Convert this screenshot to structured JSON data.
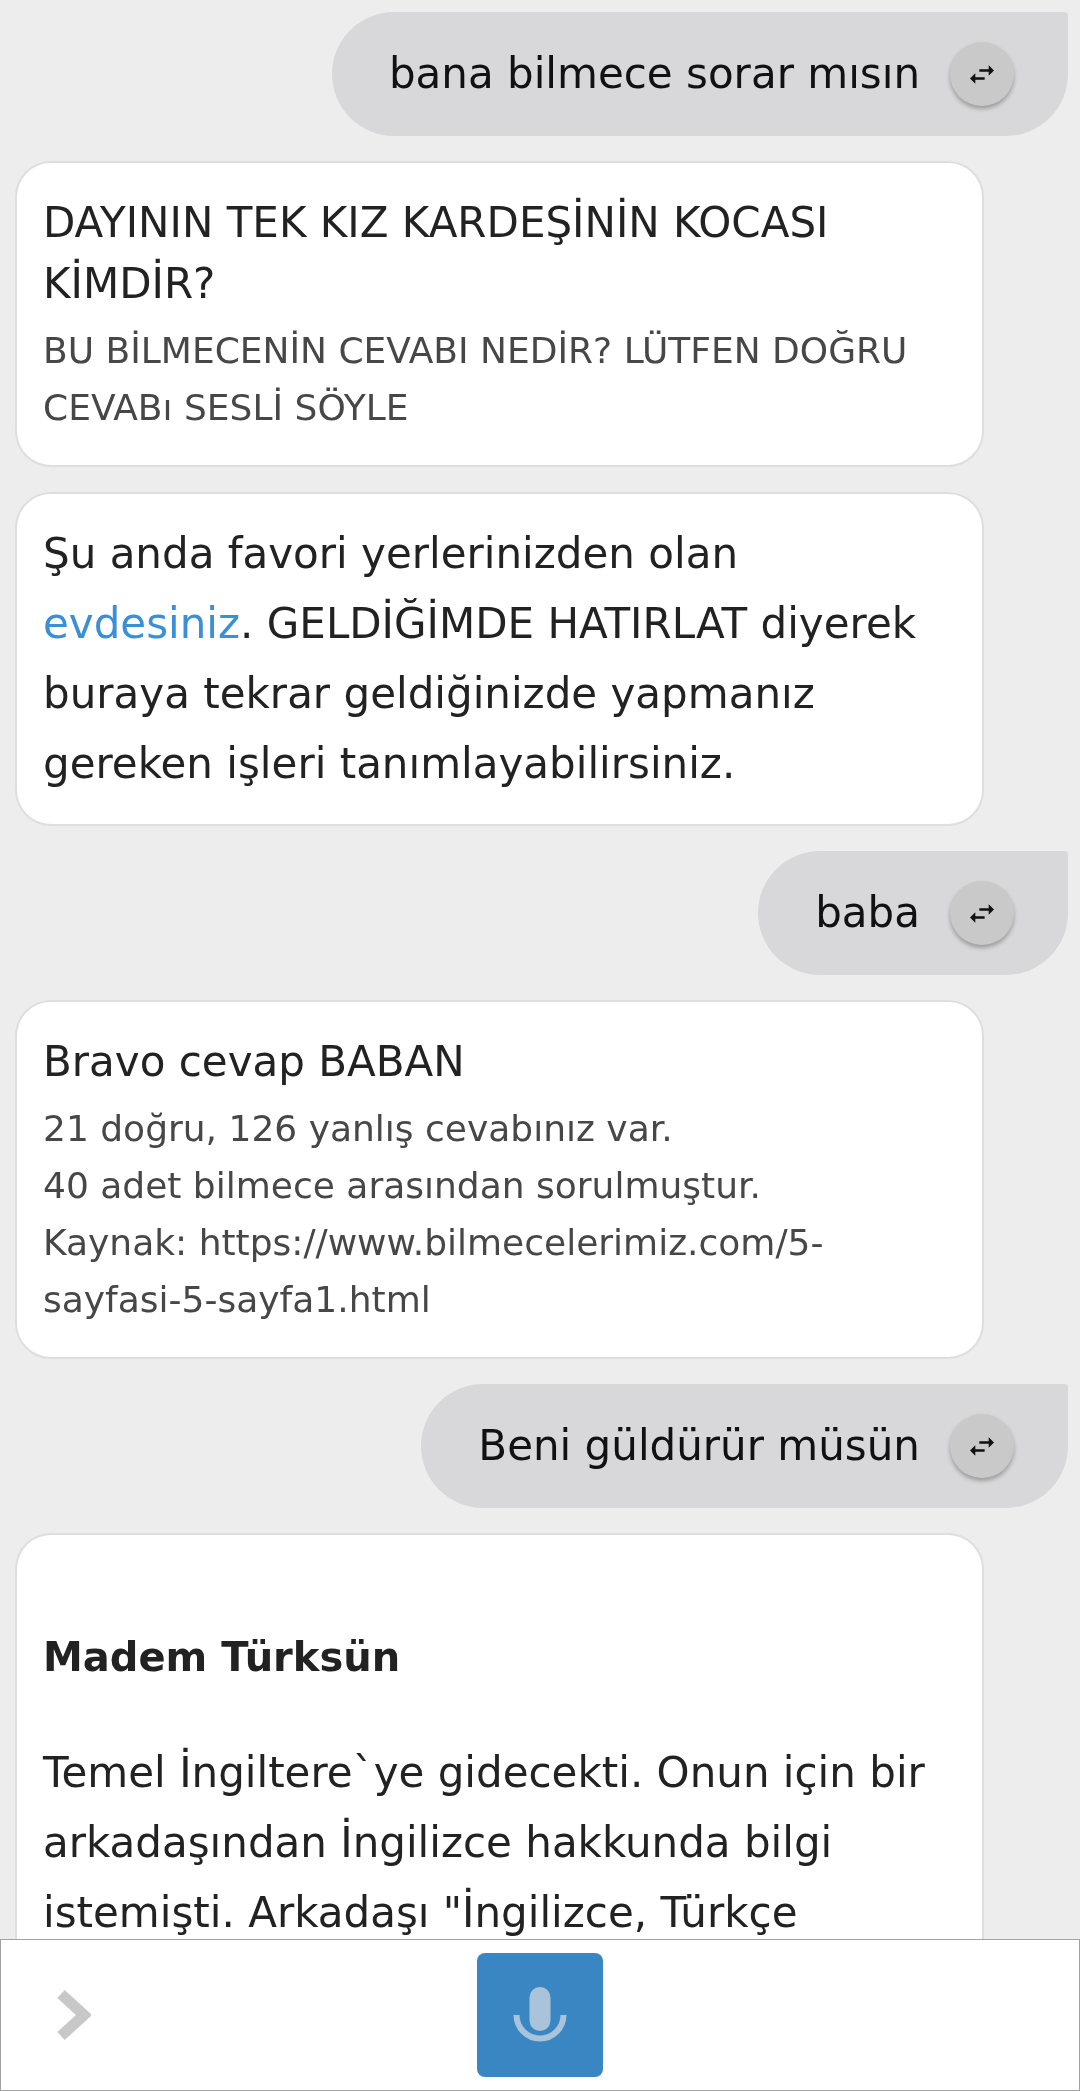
{
  "messages": [
    {
      "kind": "user",
      "text": "bana bilmece sorar mısın"
    },
    {
      "kind": "bot",
      "blocks": [
        {
          "kind": "heading",
          "text": "DAYININ TEK KIZ KARDEŞİNİN KOCASI KİMDİR?"
        },
        {
          "kind": "note",
          "text": "BU BİLMECENİN CEVABI NEDİR? LÜTFEN DOĞRU CEVABı SESLİ SÖYLE"
        }
      ]
    },
    {
      "kind": "bot",
      "blocks": [
        {
          "kind": "paragraph",
          "segments": [
            {
              "kind": "text",
              "text": "Şu anda favori yerlerinizden olan "
            },
            {
              "kind": "link",
              "text": "evdesiniz"
            },
            {
              "kind": "text",
              "text": ". GELDİĞİMDE HATIRLAT diyerek buraya tekrar geldiğinizde yapmanız gereken işleri tanımlayabilirsiniz."
            }
          ]
        }
      ]
    },
    {
      "kind": "user",
      "text": "baba"
    },
    {
      "kind": "bot",
      "blocks": [
        {
          "kind": "heading",
          "text": "Bravo cevap BABAN"
        },
        {
          "kind": "note",
          "text": "21 doğru, 126 yanlış cevabınız var."
        },
        {
          "kind": "note",
          "text": "40 adet bilmece arasından sorulmuştur."
        },
        {
          "kind": "note",
          "text": "Kaynak: https://www.bilmecelerimiz.com/5-sayfasi-5-sayfa1.html"
        }
      ]
    },
    {
      "kind": "user",
      "text": "Beni güldürür müsün"
    },
    {
      "kind": "bot",
      "blocks": [
        {
          "kind": "title",
          "text": "Madem Türksün"
        },
        {
          "kind": "paragraph",
          "segments": [
            {
              "kind": "text",
              "text": "Temel İngiltere`ye gidecekti. Onun için bir arkadaşından İngilizce hakkunda bilgi istemişti. Arkadaşı \"İngilizce, Türkçe"
            }
          ]
        }
      ]
    }
  ]
}
